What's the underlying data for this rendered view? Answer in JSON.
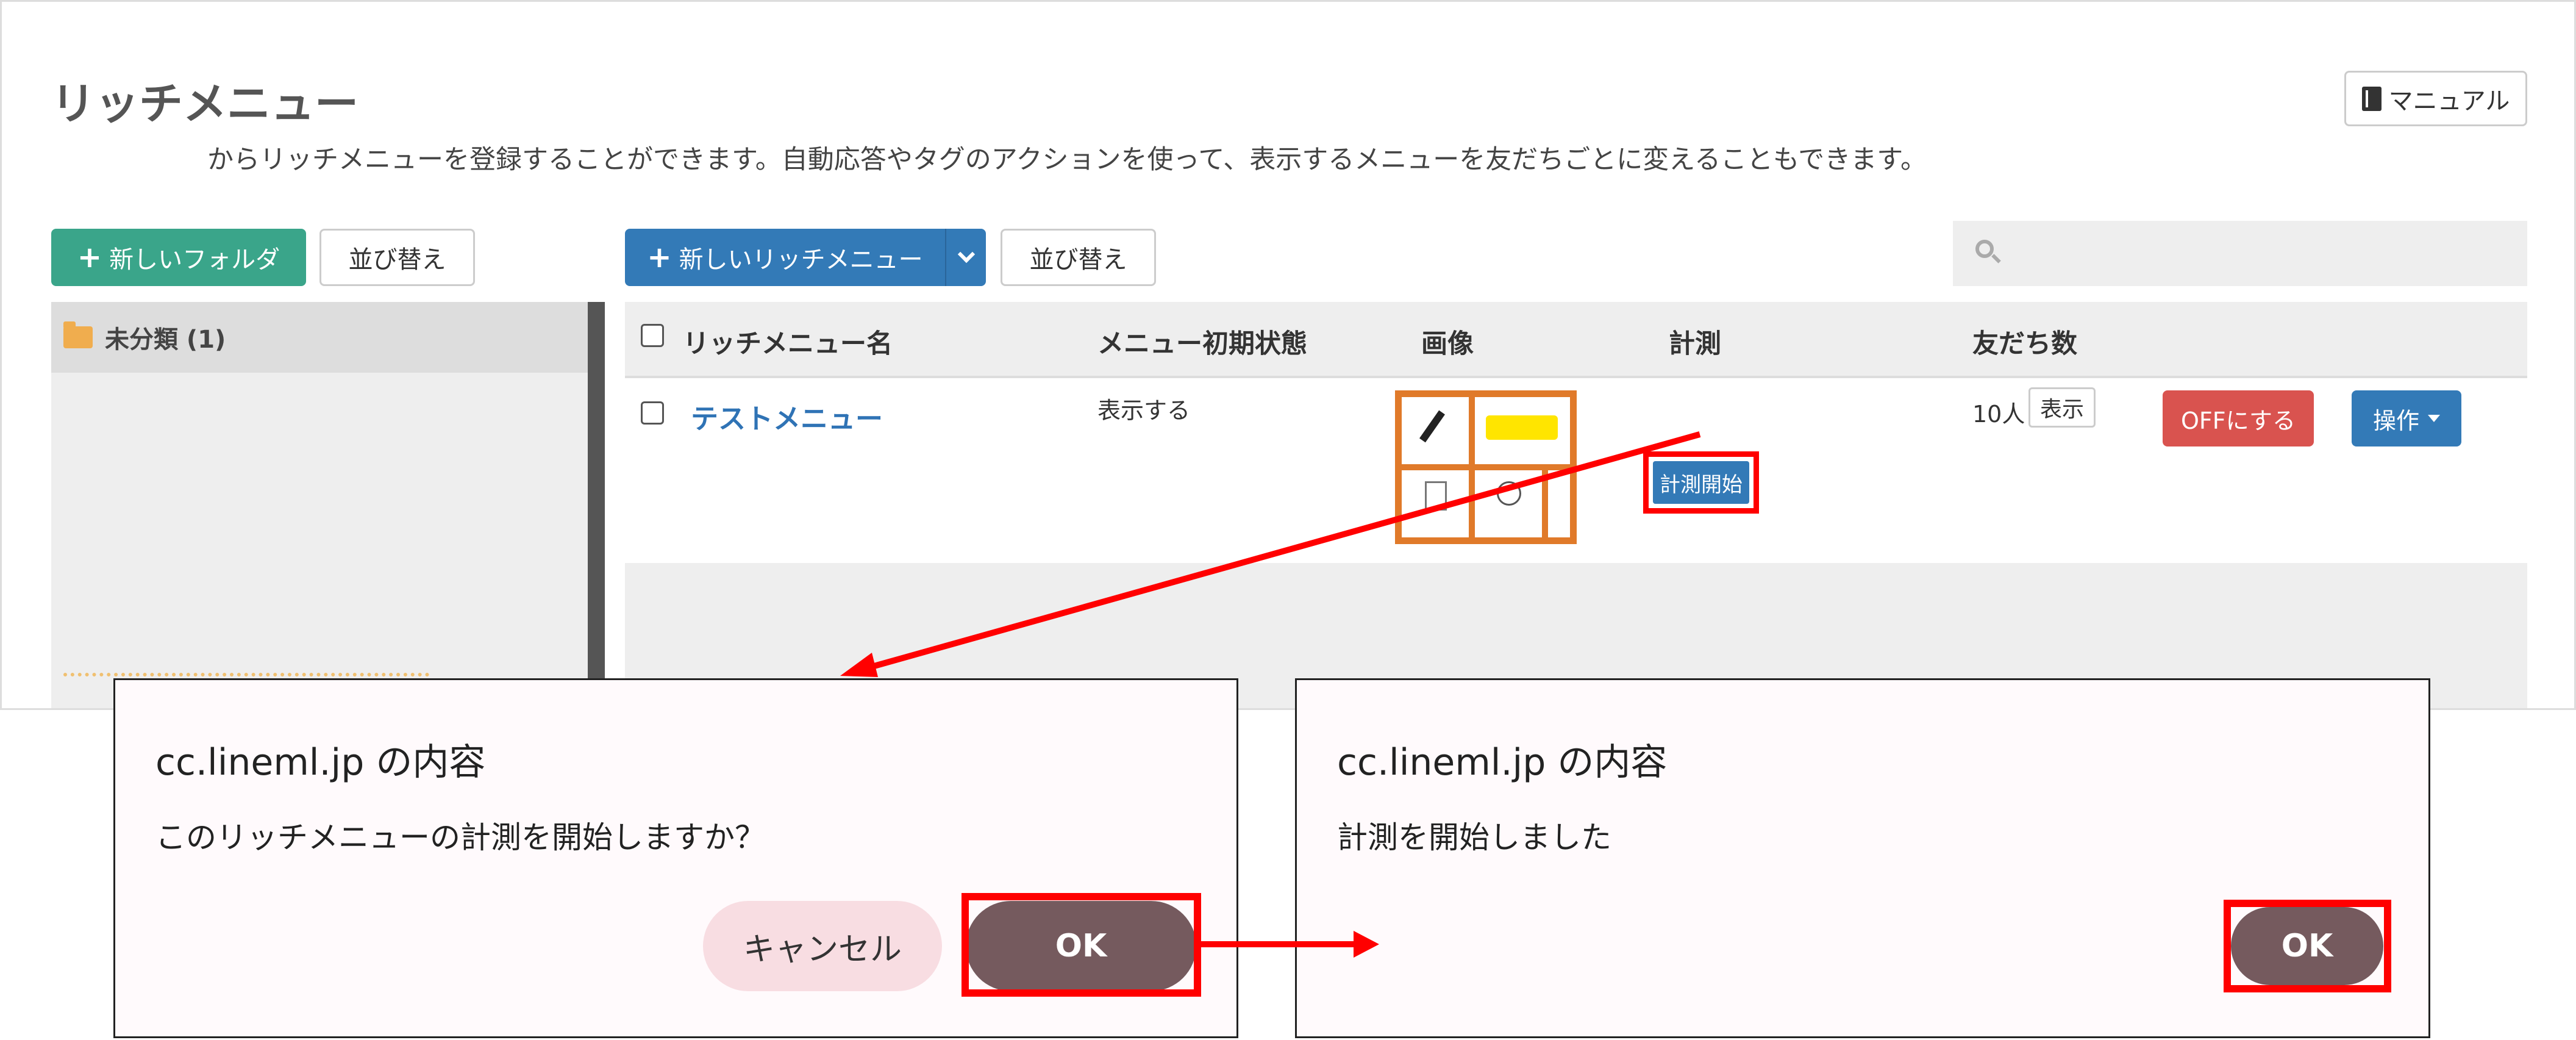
{
  "app": {
    "title": "リッチメニュー",
    "description": "からリッチメニューを登録することができます。自動応答やタグのアクションを使って、表示するメニューを友だちごとに変えることもできます。",
    "manual_label": "マニュアル"
  },
  "toolbar": {
    "new_folder_label": "新しいフォルダ",
    "folder_sort_label": "並び替え",
    "new_menu_label": "新しいリッチメニュー",
    "menu_sort_label": "並び替え",
    "search_placeholder": ""
  },
  "folders": {
    "items": [
      {
        "label": "未分類 (1)"
      }
    ]
  },
  "table": {
    "columns": [
      "リッチメニュー名",
      "メニュー初期状態",
      "画像",
      "計測",
      "友だち数"
    ],
    "rows": [
      {
        "name": "テストメニュー",
        "initial_state": "表示する",
        "measure_label": "計測開始",
        "friends": "10人",
        "show_label": "表示",
        "off_label": "OFFにする",
        "ops_label": "操作"
      }
    ]
  },
  "dialog_confirm": {
    "title": "cc.lineml.jp の内容",
    "message": "このリッチメニューの計測を開始しますか？",
    "cancel_label": "キャンセル",
    "ok_label": "OK"
  },
  "dialog_done": {
    "title": "cc.lineml.jp の内容",
    "message": "計測を開始しました",
    "ok_label": "OK"
  },
  "colors": {
    "highlight": "#ff0000",
    "primary": "#337ab7",
    "success": "#3aa58a",
    "danger": "#d9534f",
    "dialog_ok": "#755a5e",
    "dialog_cancel": "#f8dde2",
    "thumb_border": "#e07a2a"
  }
}
